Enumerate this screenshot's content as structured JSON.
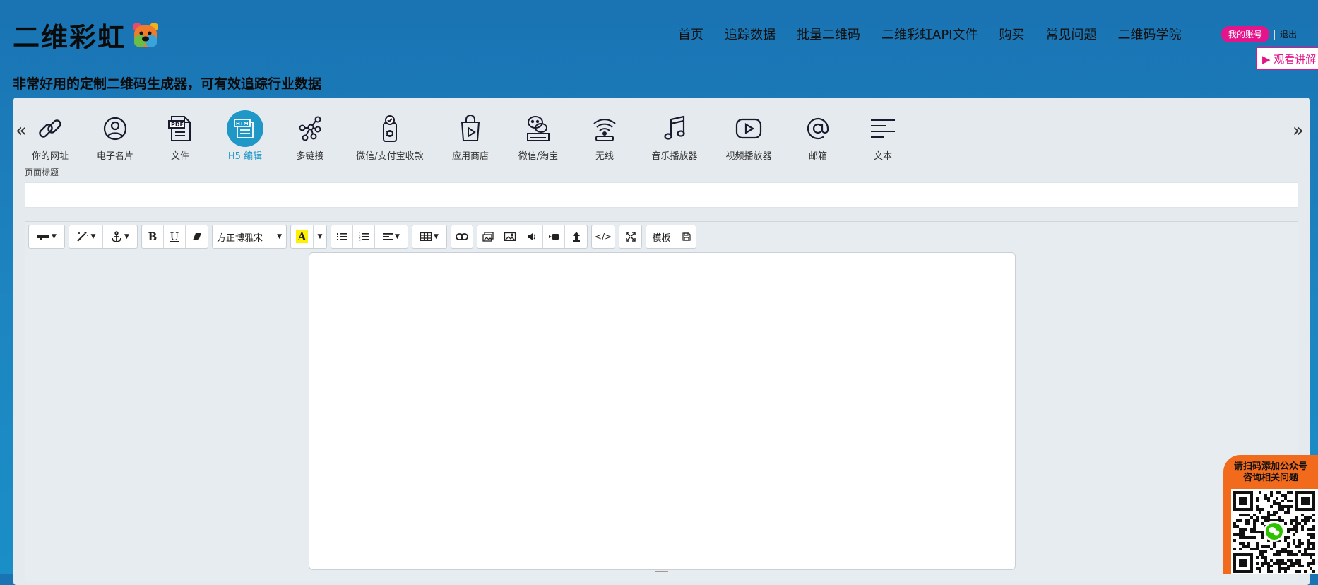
{
  "header": {
    "logo_text": "二维彩虹",
    "nav": [
      "首页",
      "追踪数据",
      "批量二维码",
      "二维彩虹API文件",
      "购买",
      "常见问题",
      "二维码学院"
    ],
    "account_label": "我的账号",
    "logout_label": "退出",
    "watch_label": "▶ 观看讲解"
  },
  "tagline": "非常好用的定制二维码生成器，可有效追踪行业数据",
  "categories": {
    "active_index": 3,
    "items": [
      {
        "label": "你的网址",
        "icon": "link-icon"
      },
      {
        "label": "电子名片",
        "icon": "user-icon"
      },
      {
        "label": "文件",
        "icon": "pdf-file-icon"
      },
      {
        "label": "H5 编辑",
        "icon": "html-icon"
      },
      {
        "label": "多链接",
        "icon": "multi-link-icon"
      },
      {
        "label": "微信/支付宝收款",
        "icon": "payment-icon"
      },
      {
        "label": "应用商店",
        "icon": "app-store-icon"
      },
      {
        "label": "微信/淘宝",
        "icon": "wechat-icon"
      },
      {
        "label": "无线",
        "icon": "wifi-icon"
      },
      {
        "label": "音乐播放器",
        "icon": "music-icon"
      },
      {
        "label": "视频播放器",
        "icon": "video-icon"
      },
      {
        "label": "邮箱",
        "icon": "email-icon"
      },
      {
        "label": "文本",
        "icon": "text-icon"
      }
    ]
  },
  "form": {
    "title_label": "页面标题",
    "title_value": ""
  },
  "editor": {
    "font_select": "方正博雅宋",
    "color_btn": "A",
    "html_btn": "</>",
    "template_btn": "模板",
    "bold": "B",
    "underline": "U"
  },
  "wechat_promo": {
    "line1": "请扫码添加公众号",
    "line2": "咨询相关问题"
  },
  "colors": {
    "accent": "#1f98c7",
    "pink": "#e4148a",
    "orange": "#f26a1b"
  }
}
